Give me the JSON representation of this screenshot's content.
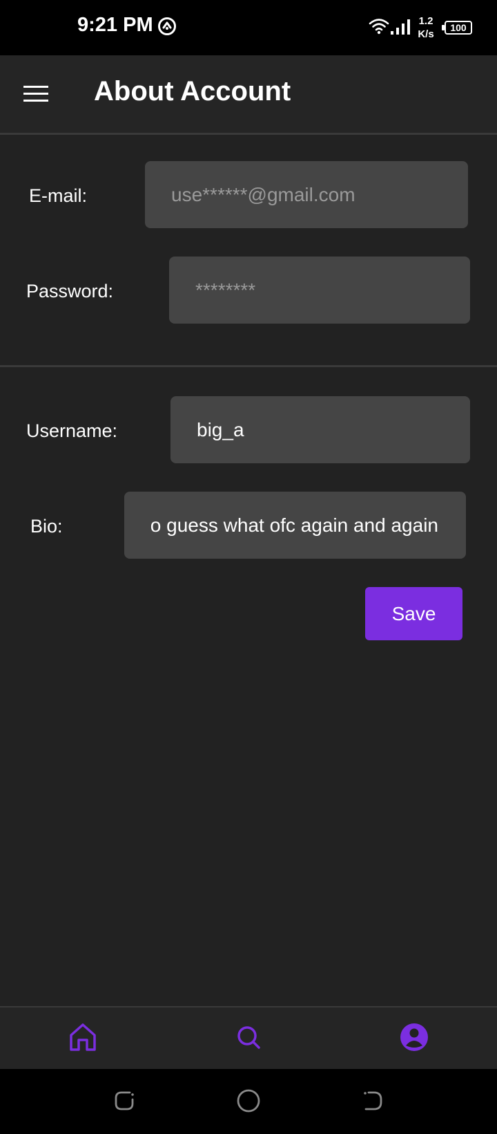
{
  "status_bar": {
    "time": "9:21 PM",
    "speed_value": "1.2",
    "speed_unit": "K/s",
    "battery": "100",
    "icons": [
      "app-status-icon",
      "wifi-icon",
      "signal-icon",
      "battery-icon"
    ]
  },
  "header": {
    "title": "About Account",
    "menu_icon": "hamburger-menu-icon"
  },
  "form": {
    "email_label": "E-mail:",
    "email_placeholder": "use******@gmail.com",
    "password_label": "Password:",
    "password_placeholder": "********",
    "username_label": "Username:",
    "username_value": "big_a",
    "bio_label": "Bio:",
    "bio_value": "o guess what ofc again and again",
    "save_label": "Save"
  },
  "bottom_nav": {
    "items": [
      {
        "name": "home",
        "icon": "home-icon"
      },
      {
        "name": "search",
        "icon": "search-icon"
      },
      {
        "name": "profile",
        "icon": "profile-icon"
      }
    ]
  },
  "system_nav": {
    "buttons": [
      "recents-icon",
      "home-circle-icon",
      "back-icon"
    ]
  },
  "colors": {
    "accent": "#7b2ee0",
    "background": "#222222",
    "field": "#454545",
    "placeholder": "#9a9a9a"
  }
}
